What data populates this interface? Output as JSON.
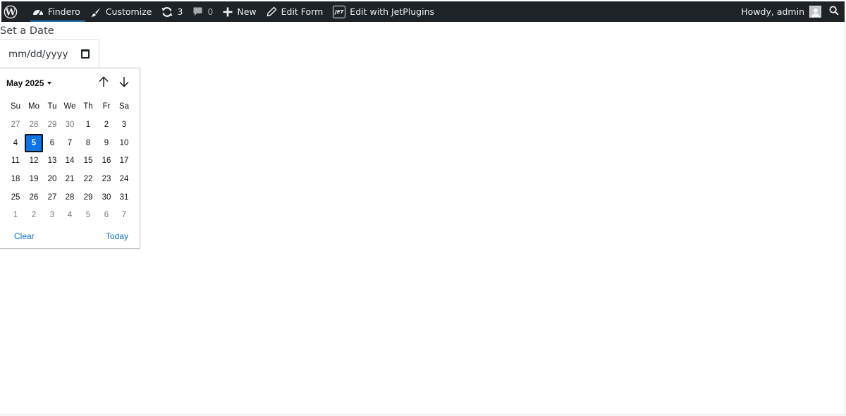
{
  "adminbar": {
    "site_name": "Findero",
    "customize_label": "Customize",
    "updates_count": "3",
    "comments_count": "0",
    "new_label": "New",
    "edit_form_label": "Edit Form",
    "jet_badge_text": "JET",
    "edit_jetplugins_label": "Edit with JetPlugins",
    "howdy_label": "Howdy, admin"
  },
  "form": {
    "field_label": "Set a Date",
    "placeholder": "mm/dd/yyyy"
  },
  "calendar": {
    "month_year": "May 2025",
    "weekdays": [
      "Su",
      "Mo",
      "Tu",
      "We",
      "Th",
      "Fr",
      "Sa"
    ],
    "weeks": [
      [
        "27",
        "28",
        "29",
        "30",
        "1",
        "2",
        "3"
      ],
      [
        "4",
        "5",
        "6",
        "7",
        "8",
        "9",
        "10"
      ],
      [
        "11",
        "12",
        "13",
        "14",
        "15",
        "16",
        "17"
      ],
      [
        "18",
        "19",
        "20",
        "21",
        "22",
        "23",
        "24"
      ],
      [
        "25",
        "26",
        "27",
        "28",
        "29",
        "30",
        "31"
      ],
      [
        "1",
        "2",
        "3",
        "4",
        "5",
        "6",
        "7"
      ]
    ],
    "selected_day": "5",
    "clear_label": "Clear",
    "today_label": "Today"
  },
  "colors": {
    "adminbar_bg": "#1d2327",
    "accent": "#2271b1",
    "selected_day_bg": "#0b72e7",
    "link": "#0b72c8"
  },
  "icons": [
    "wordpress-icon",
    "dashboard-icon",
    "brush-icon",
    "refresh-icon",
    "comment-icon",
    "plus-icon",
    "pencil-icon",
    "jet-icon",
    "avatar",
    "search-icon",
    "calendar-icon",
    "arrow-up-icon",
    "arrow-down-icon",
    "caret-down-icon"
  ]
}
